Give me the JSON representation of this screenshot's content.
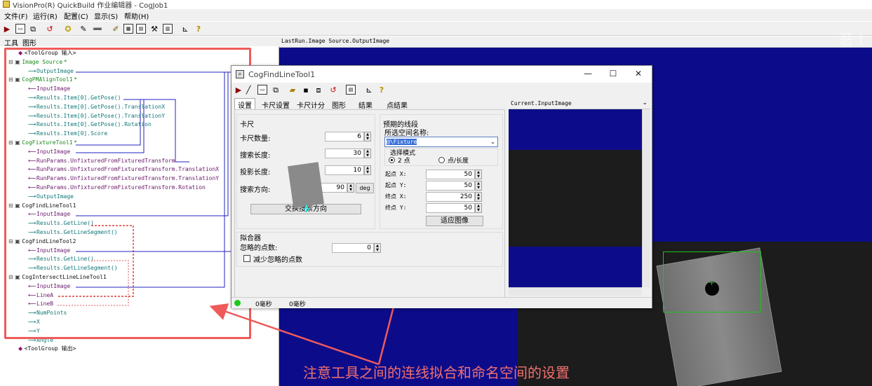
{
  "window": {
    "title": "VisionPro(R) QuickBuild 作业编辑器 - CogJob1"
  },
  "menu": [
    "文件(F)",
    "运行(R)",
    "配置(C)",
    "显示(S)",
    "帮助(H)"
  ],
  "left_tabs": [
    "工具",
    "图形"
  ],
  "tree": [
    {
      "text": "<ToolGroup 输入>",
      "color": "dark"
    },
    {
      "text": "Image Source",
      "color": "green",
      "star": "*"
    },
    {
      "text": "OutputImage",
      "color": "teal"
    },
    {
      "text": "CogPMAlignTool1",
      "color": "green",
      "star": "*"
    },
    {
      "text": "InputImage",
      "color": "purple"
    },
    {
      "text": "Results.Item[0].GetPose()",
      "color": "teal"
    },
    {
      "text": "Results.Item[0].GetPose().TranslationX",
      "color": "teal"
    },
    {
      "text": "Results.Item[0].GetPose().TranslationY",
      "color": "teal"
    },
    {
      "text": "Results.Item[0].GetPose().Rotation",
      "color": "teal"
    },
    {
      "text": "Results.Item[0].Score",
      "color": "teal"
    },
    {
      "text": "CogFixtureTool1",
      "color": "green",
      "star": "*"
    },
    {
      "text": "InputImage",
      "color": "purple"
    },
    {
      "text": "RunParams.UnfixturedFromFixturedTransform",
      "color": "purple"
    },
    {
      "text": "RunParams.UnfixturedFromFixturedTransform.TranslationX",
      "color": "purple"
    },
    {
      "text": "RunParams.UnfixturedFromFixturedTransform.TranslationY",
      "color": "purple"
    },
    {
      "text": "RunParams.UnfixturedFromFixturedTransform.Rotation",
      "color": "purple"
    },
    {
      "text": "OutputImage",
      "color": "teal"
    },
    {
      "text": "CogFindLineTool1",
      "color": "dark"
    },
    {
      "text": "InputImage",
      "color": "purple"
    },
    {
      "text": "Results.GetLine()",
      "color": "teal"
    },
    {
      "text": "Results.GetLineSegment()",
      "color": "teal"
    },
    {
      "text": "CogFindLineTool2",
      "color": "dark"
    },
    {
      "text": "InputImage",
      "color": "purple"
    },
    {
      "text": "Results.GetLine()",
      "color": "teal"
    },
    {
      "text": "Results.GetLineSegment()",
      "color": "teal"
    },
    {
      "text": "CogIntersectLineLineTool1",
      "color": "dark"
    },
    {
      "text": "InputImage",
      "color": "purple"
    },
    {
      "text": "LineA",
      "color": "purple"
    },
    {
      "text": "LineB",
      "color": "purple"
    },
    {
      "text": "NumPoints",
      "color": "teal"
    },
    {
      "text": "X",
      "color": "teal"
    },
    {
      "text": "Y",
      "color": "teal"
    },
    {
      "text": "Angle",
      "color": "teal"
    },
    {
      "text": "<ToolGroup 输出>",
      "color": "dark"
    }
  ],
  "image_header": "LastRun.Image Source.OutputImage",
  "watermark": "著 I",
  "caption": "注意工具之间的连线拟合和命名空间的设置",
  "dialog": {
    "title": "CogFindLineTool1",
    "tabs": [
      "设置",
      "卡尺设置",
      "卡尺计分",
      "图形",
      "结果",
      "点结果"
    ],
    "caliper": {
      "group": "卡尺",
      "count_label": "卡尺数量:",
      "count": "6",
      "search_len_label": "搜索长度:",
      "search_len": "30",
      "proj_len_label": "投影长度:",
      "proj_len": "10",
      "dir_label": "搜索方向:",
      "dir": "90",
      "dir_unit": "deg",
      "swap_button": "交换搜索方向"
    },
    "expected": {
      "group": "预期的线段",
      "ns_label": "所选空间名称:",
      "ns_value": "@\\Fixture",
      "mode_label": "选择模式",
      "mode_2pt": "2 点",
      "mode_pt_len": "点/长度",
      "sx_label": "起点 X:",
      "sx": "50",
      "sy_label": "起点 Y:",
      "sy": "50",
      "ex_label": "终点 X:",
      "ex": "250",
      "ey_label": "终点 Y:",
      "ey": "50",
      "fit_button": "适应图像"
    },
    "fitter": {
      "group": "拟合器",
      "ignore_label": "忽略的点数:",
      "ignore": "0",
      "reduce_label": "减少忽略的点数"
    },
    "image_header": "Current.InputImage",
    "status": [
      "0毫秒",
      "0毫秒"
    ]
  }
}
